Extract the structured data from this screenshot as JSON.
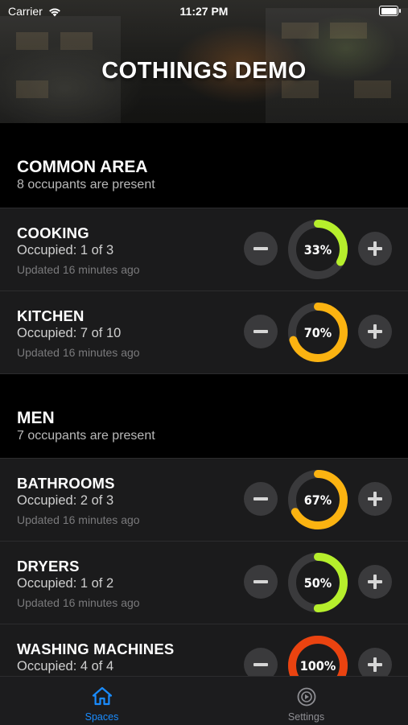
{
  "status": {
    "carrier": "Carrier",
    "time": "11:27 PM"
  },
  "app": {
    "title": "COTHINGS DEMO"
  },
  "sections": [
    {
      "title": "COMMON AREA",
      "subtitle": "8 occupants are present",
      "rows": [
        {
          "name": "COOKING",
          "occupied": "Occupied: 1 of 3",
          "updated": "Updated 16 minutes ago",
          "percent_label": "33%",
          "fraction": 0.33,
          "color": "#b6ef2c"
        },
        {
          "name": "KITCHEN",
          "occupied": "Occupied: 7 of 10",
          "updated": "Updated 16 minutes ago",
          "percent_label": "70%",
          "fraction": 0.7,
          "color": "#fbb311"
        }
      ]
    },
    {
      "title": "MEN",
      "subtitle": "7 occupants are present",
      "rows": [
        {
          "name": "BATHROOMS",
          "occupied": "Occupied: 2 of 3",
          "updated": "Updated 16 minutes ago",
          "percent_label": "67%",
          "fraction": 0.67,
          "color": "#fbb311"
        },
        {
          "name": "DRYERS",
          "occupied": "Occupied: 1 of 2",
          "updated": "Updated 16 minutes ago",
          "percent_label": "50%",
          "fraction": 0.5,
          "color": "#b6ef2c"
        },
        {
          "name": "WASHING MACHINES",
          "occupied": "Occupied: 4 of 4",
          "updated": "",
          "percent_label": "100%",
          "fraction": 1.0,
          "color": "#ea4310"
        }
      ]
    }
  ],
  "tabs": [
    {
      "label": "Spaces",
      "icon": "home-icon",
      "selected": true
    },
    {
      "label": "Settings",
      "icon": "settings-icon",
      "selected": false
    }
  ],
  "colors": {
    "accent": "#1a8cff",
    "track": "#3a3a3c"
  }
}
